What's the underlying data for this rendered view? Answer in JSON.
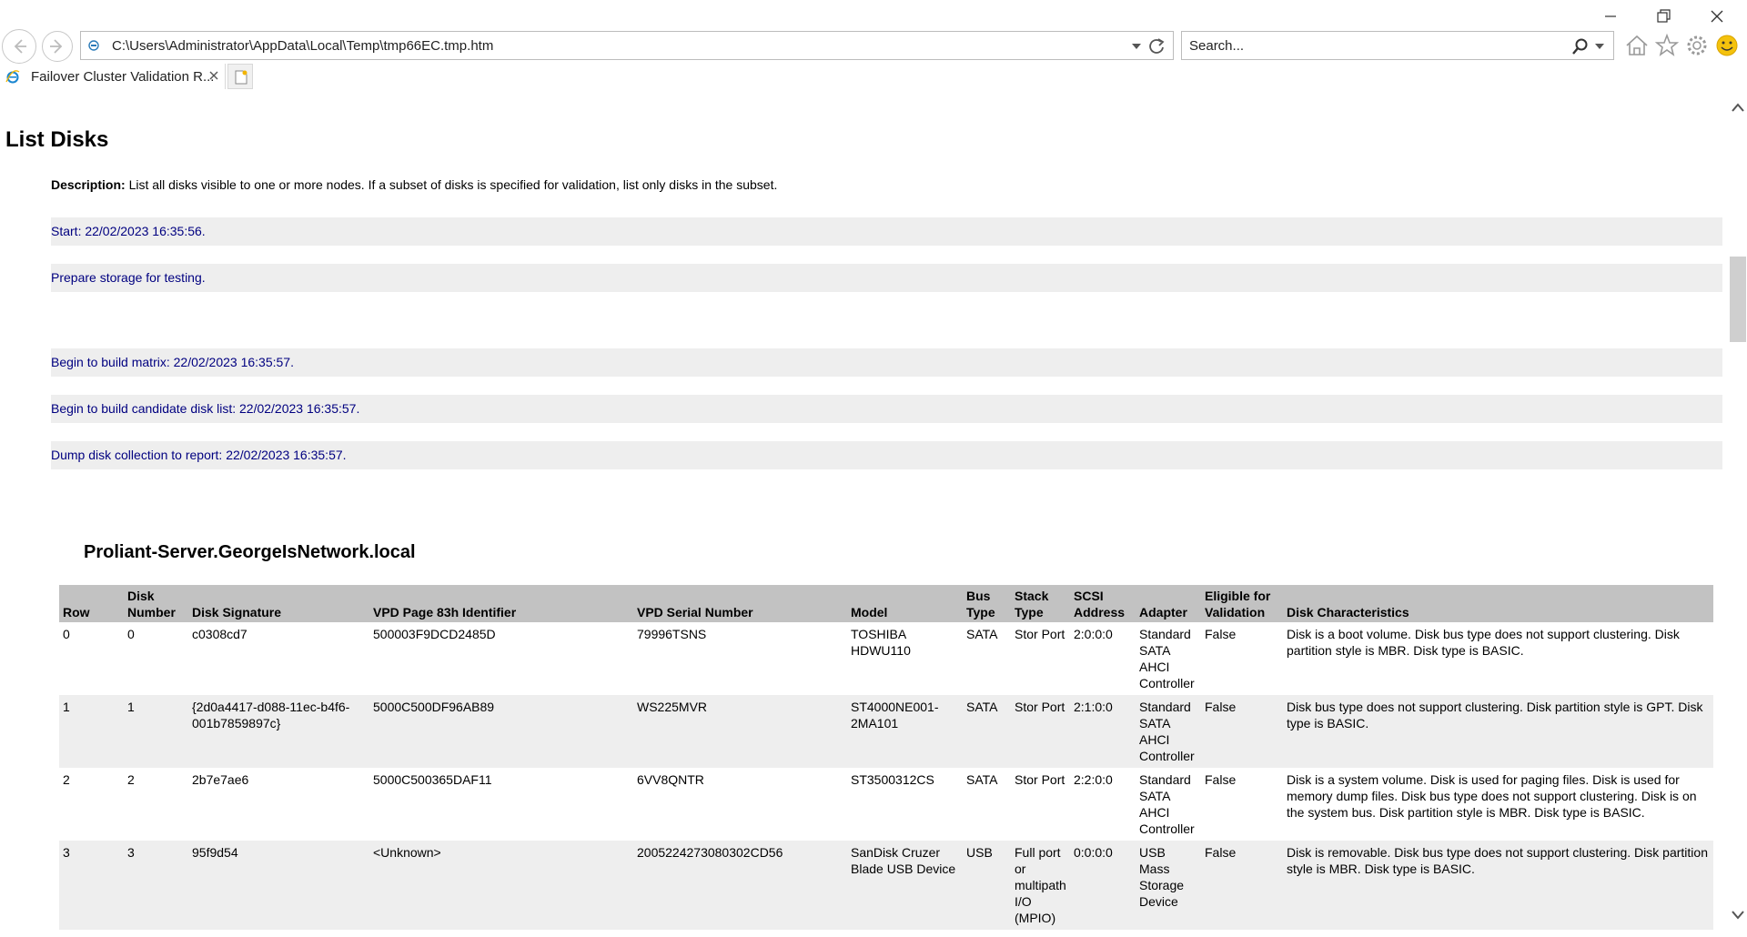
{
  "browser": {
    "url": "C:\\Users\\Administrator\\AppData\\Local\\Temp\\tmp66EC.tmp.htm",
    "search_placeholder": "Search...",
    "tab_title": "Failover Cluster Validation R...",
    "icons": [
      "back-icon",
      "forward-icon",
      "refresh-icon",
      "search-icon",
      "home-icon",
      "favorites-star-icon",
      "gear-icon",
      "smiley-icon"
    ]
  },
  "page": {
    "heading": "List Disks",
    "description_label": "Description:",
    "description_text": " List all disks visible to one or more nodes. If a subset of disks is specified for validation, list only disks in the subset.",
    "log_entries": [
      "Start: 22/02/2023 16:35:56.",
      "Prepare storage for testing.",
      "Begin to build matrix: 22/02/2023 16:35:57.",
      "Begin to build candidate disk list: 22/02/2023 16:35:57.",
      "Dump disk collection to report: 22/02/2023 16:35:57."
    ],
    "node_name": "Proliant-Server.GeorgeIsNetwork.local"
  },
  "table": {
    "headers": [
      "Row",
      "Disk Number",
      "Disk Signature",
      "VPD Page 83h Identifier",
      "VPD Serial Number",
      "Model",
      "Bus Type",
      "Stack Type",
      "SCSI Address",
      "Adapter",
      "Eligible for Validation",
      "Disk Characteristics"
    ],
    "rows": [
      [
        "0",
        "0",
        "c0308cd7",
        "500003F9DCD2485D",
        "79996TSNS",
        "TOSHIBA HDWU110",
        "SATA",
        "Stor Port",
        "2:0:0:0",
        "Standard SATA AHCI Controller",
        "False",
        "Disk is a boot volume. Disk bus type does not support clustering. Disk partition style is MBR. Disk type is BASIC."
      ],
      [
        "1",
        "1",
        "{2d0a4417-d088-11ec-b4f6-001b7859897c}",
        "5000C500DF96AB89",
        "WS225MVR",
        "ST4000NE001-2MA101",
        "SATA",
        "Stor Port",
        "2:1:0:0",
        "Standard SATA AHCI Controller",
        "False",
        "Disk bus type does not support clustering. Disk partition style is GPT. Disk type is BASIC."
      ],
      [
        "2",
        "2",
        "2b7e7ae6",
        "5000C500365DAF11",
        "6VV8QNTR",
        "ST3500312CS",
        "SATA",
        "Stor Port",
        "2:2:0:0",
        "Standard SATA AHCI Controller",
        "False",
        "Disk is a system volume. Disk is used for paging files. Disk is used for memory dump files. Disk bus type does not support clustering. Disk is on the system bus. Disk partition style is MBR. Disk type is BASIC."
      ],
      [
        "3",
        "3",
        "95f9d54",
        "<Unknown>",
        "2005224273080302CD56",
        "SanDisk Cruzer Blade USB Device",
        "USB",
        "Full port or multipath I/O (MPIO)",
        "0:0:0:0",
        "USB Mass Storage Device",
        "False",
        "Disk is removable. Disk bus type does not support clustering. Disk partition style is MBR. Disk type is BASIC."
      ]
    ]
  }
}
